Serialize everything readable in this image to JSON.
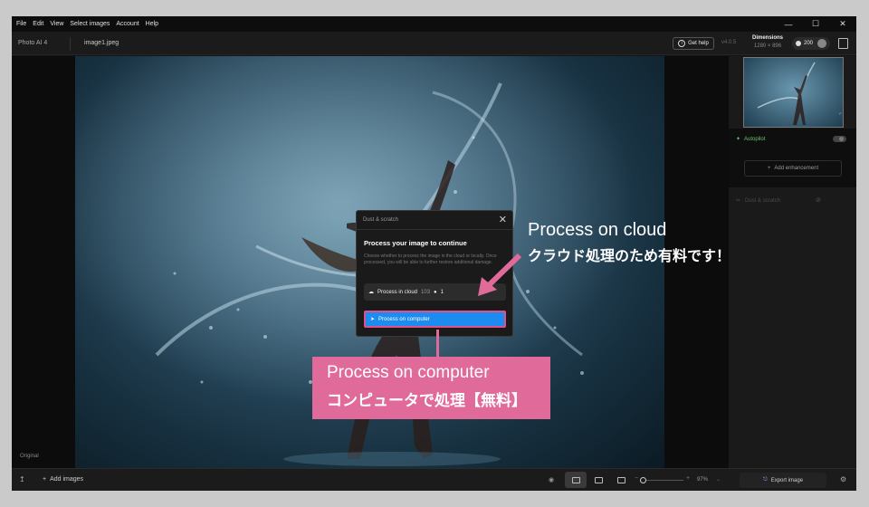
{
  "menubar": {
    "items": [
      "File",
      "Edit",
      "View",
      "Select images",
      "Account",
      "Help"
    ]
  },
  "titlebar": {
    "app_name": "Photo AI  4",
    "file_name": "image1.jpeg",
    "help_label": "Get help",
    "version": "v4.0.5",
    "dimensions_label": "Dimensions",
    "dimensions_value": "1280 × 896",
    "credits": "200"
  },
  "canvas": {
    "view_label": "Original"
  },
  "right_panel": {
    "autopilot_label": "Autopilot",
    "add_enhancement_label": "Add enhancement",
    "dust_label": "Dust & scratch"
  },
  "bottombar": {
    "add_images_label": "Add images",
    "zoom_value": "97%",
    "export_label": "Export image"
  },
  "dialog": {
    "header": "Dust & scratch",
    "heading": "Process your image to continue",
    "description": "Choose whether to process the image in the cloud or locally. Once processed, you will be able to further restore additional damage.",
    "cloud_label": "Process in cloud",
    "cloud_cost_a": "103",
    "cloud_cost_b": "1",
    "computer_label": "Process on computer"
  },
  "callouts": {
    "cloud_en": "Process on cloud",
    "cloud_jp": "クラウド処理のため有料です！",
    "computer_en": "Process on computer",
    "computer_jp": "コンピュータで処理【無料】"
  },
  "colors": {
    "accent_blue": "#1d8cf0",
    "callout_pink": "#e06a9a",
    "autopilot_green": "#6cc070"
  }
}
